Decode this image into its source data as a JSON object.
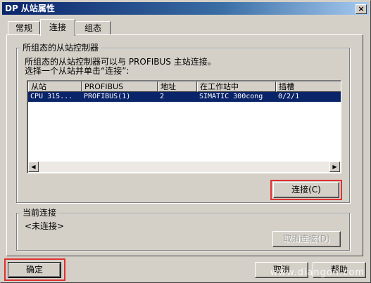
{
  "window": {
    "title": "DP 从站属性",
    "close_glyph": "×"
  },
  "tabs": [
    {
      "label": "常规",
      "active": false
    },
    {
      "label": "连接",
      "active": true
    },
    {
      "label": "组态",
      "active": false
    }
  ],
  "slaves_group": {
    "title": "所组态的从站控制器",
    "desc_line1": "所组态的从站控制器可以与 PROFIBUS 主站连接。",
    "desc_line2": "选择一个从站并单击“连接”:",
    "columns": [
      "从站",
      "PROFIBUS",
      "地址",
      "在工作站中",
      "插槽"
    ],
    "rows": [
      {
        "slave": "CPU 315...",
        "profibus": "PROFIBUS(1)",
        "address": "2",
        "station": "SIMATIC 300cong",
        "slot": "0/2/1",
        "selected": true
      }
    ],
    "connect_button": "连接(C)"
  },
  "current_group": {
    "title": "当前连接",
    "value": "<未连接>",
    "disconnect_button": "取消连接(D)"
  },
  "footer": {
    "ok_button": "确定",
    "cancel_button": "取消",
    "help_button": "帮助"
  },
  "watermark": "www.diangon.com",
  "colors": {
    "highlight_box": "#e03030",
    "selection": "#0a246a",
    "title_bar": "#0a246a"
  }
}
